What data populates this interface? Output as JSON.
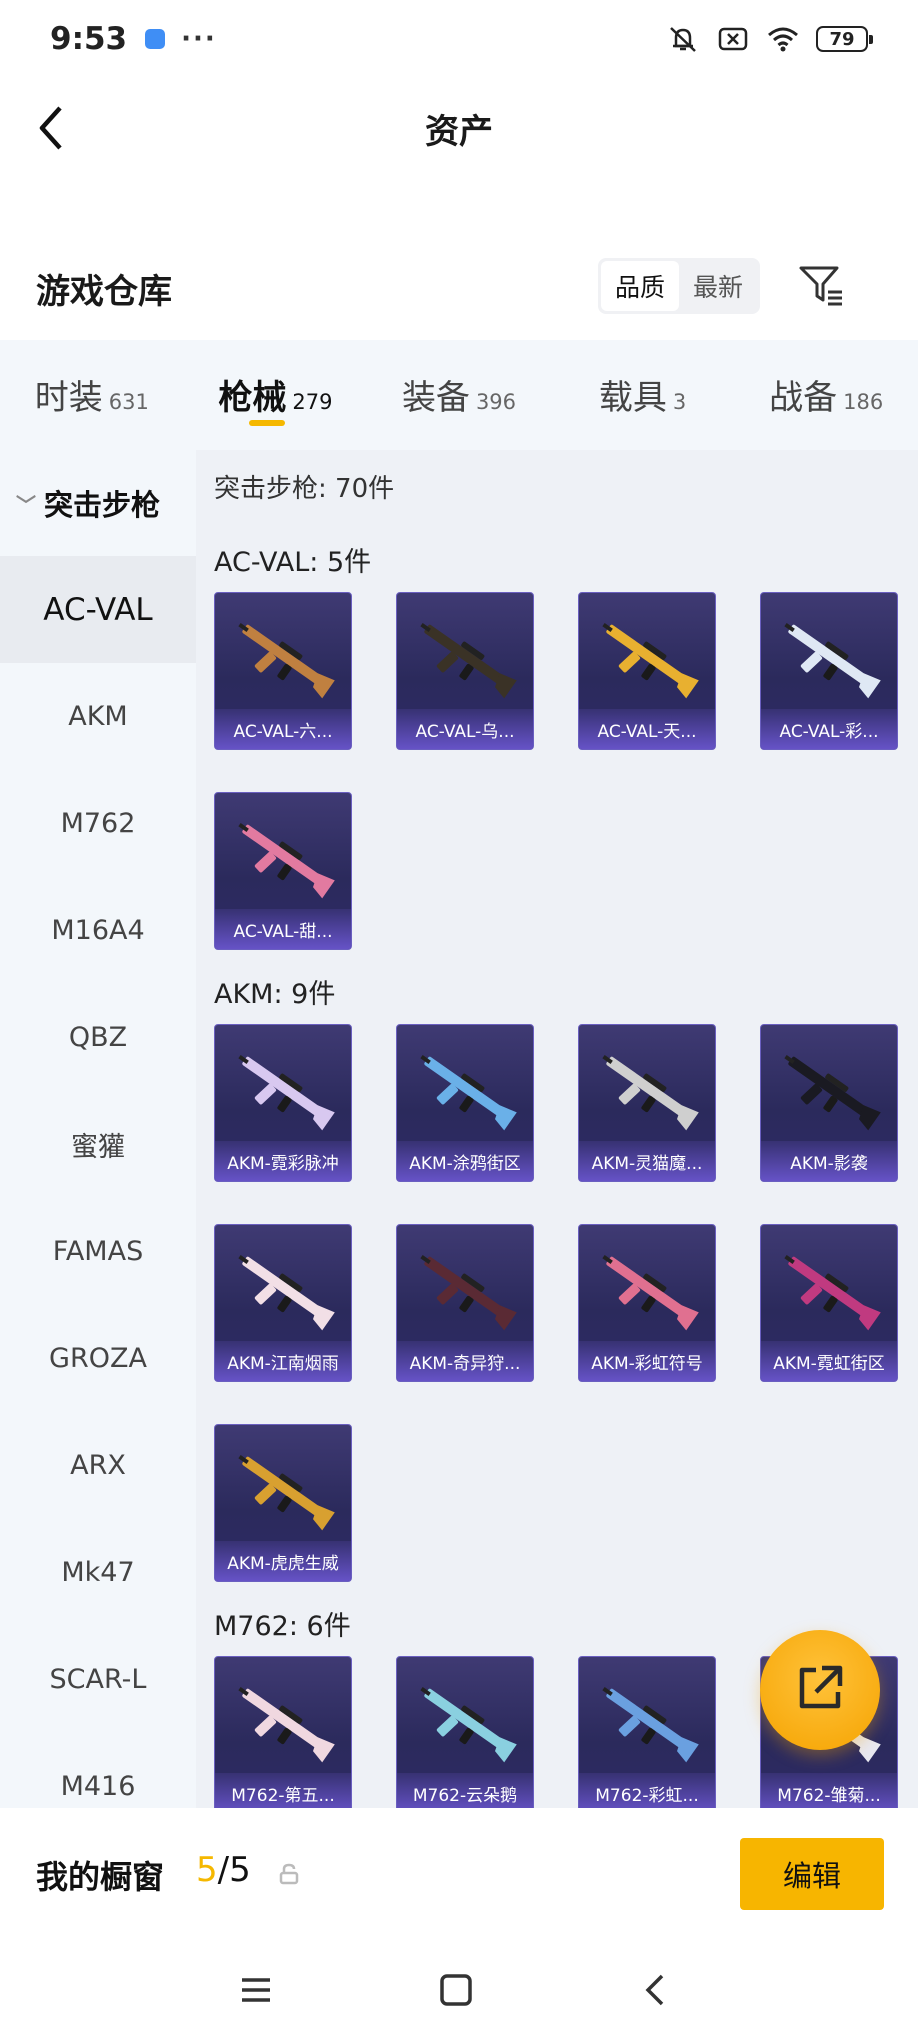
{
  "status_bar": {
    "time": "9:53",
    "more": "···",
    "battery": "79"
  },
  "header": {
    "title": "资产"
  },
  "warehouse": {
    "title": "游戏仓库",
    "sort_options": [
      "品质",
      "最新"
    ]
  },
  "tabs": [
    {
      "label": "时装",
      "count": "631"
    },
    {
      "label": "枪械",
      "count": "279"
    },
    {
      "label": "装备",
      "count": "396"
    },
    {
      "label": "载具",
      "count": "3"
    },
    {
      "label": "战备",
      "count": "186"
    }
  ],
  "sidebar": {
    "category": "突击步枪",
    "items": [
      "AC-VAL",
      "AKM",
      "M762",
      "M16A4",
      "QBZ",
      "蜜獾",
      "FAMAS",
      "GROZA",
      "ARX",
      "Mk47",
      "SCAR-L",
      "M416"
    ]
  },
  "content": {
    "category_title": "突击步枪: 70件",
    "groups": [
      {
        "title": "AC-VAL: 5件",
        "items": [
          "AC-VAL-六...",
          "AC-VAL-乌...",
          "AC-VAL-天...",
          "AC-VAL-彩...",
          "AC-VAL-甜..."
        ]
      },
      {
        "title": "AKM: 9件",
        "items": [
          "AKM-霓彩脉冲",
          "AKM-涂鸦街区",
          "AKM-灵猫魔...",
          "AKM-影袭",
          "AKM-江南烟雨",
          "AKM-奇异狩...",
          "AKM-彩虹符号",
          "AKM-霓虹街区",
          "AKM-虎虎生威"
        ]
      },
      {
        "title": "M762: 6件",
        "items": [
          "M762-第五...",
          "M762-云朵鹅",
          "M762-彩虹...",
          "M762-雏菊..."
        ]
      }
    ]
  },
  "showcase": {
    "label": "我的橱窗",
    "current": "5",
    "total": "/5",
    "edit": "编辑"
  },
  "colors": {
    "accent": "#f5b800",
    "card_bg": "#2b2a5c",
    "sidebar_bg": "#f3f7fb"
  }
}
